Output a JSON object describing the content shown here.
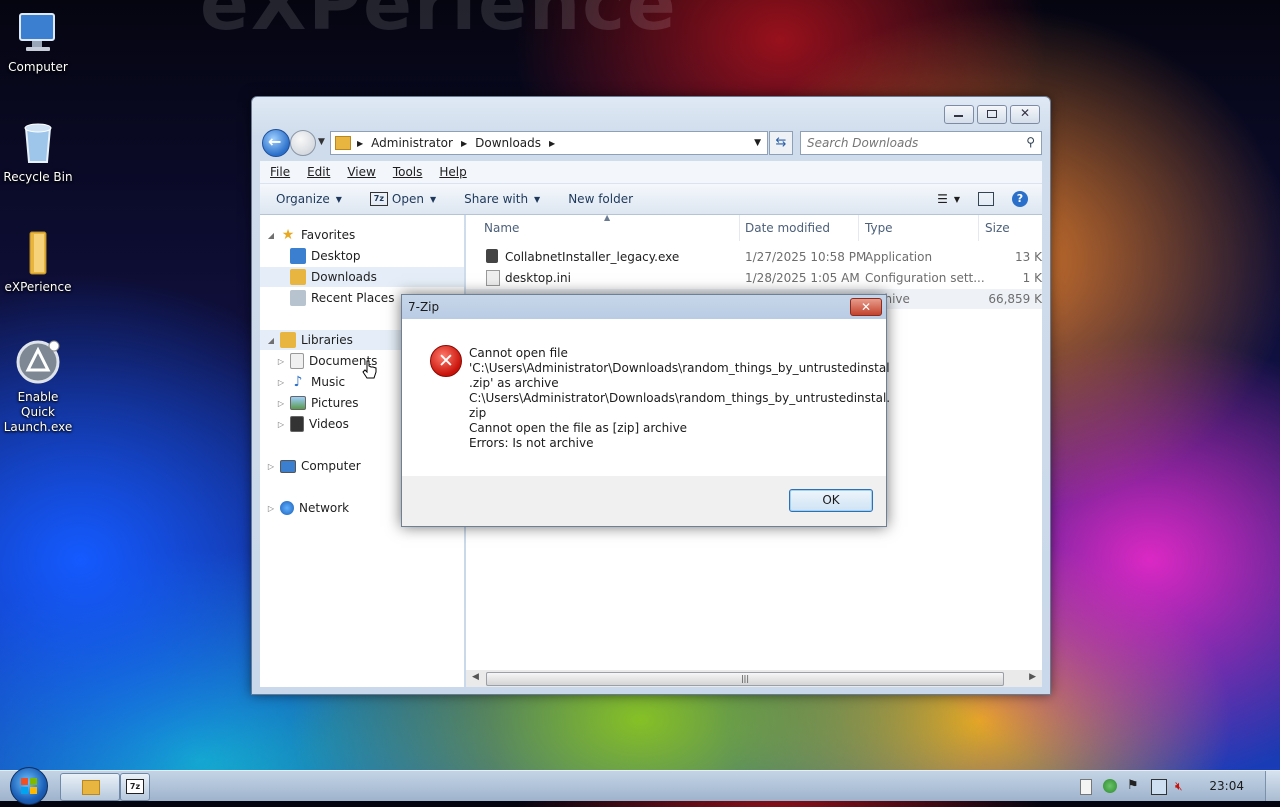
{
  "desktop": {
    "watermark": "eXPerience",
    "icons": [
      {
        "label": "Computer"
      },
      {
        "label": "Recycle Bin"
      },
      {
        "label": "eXPerience"
      },
      {
        "label": "Enable Quick Launch.exe"
      }
    ]
  },
  "explorer": {
    "breadcrumb": [
      "Administrator",
      "Downloads"
    ],
    "search_placeholder": "Search Downloads",
    "menu": [
      "File",
      "Edit",
      "View",
      "Tools",
      "Help"
    ],
    "commands": [
      "Organize",
      "Open",
      "Share with",
      "New folder"
    ],
    "nav": {
      "favorites": "Favorites",
      "favorites_items": [
        "Desktop",
        "Downloads",
        "Recent Places"
      ],
      "libraries": "Libraries",
      "libraries_items": [
        "Documents",
        "Music",
        "Pictures",
        "Videos"
      ],
      "computer": "Computer",
      "network": "Network"
    },
    "columns": [
      "Name",
      "Date modified",
      "Type",
      "Size"
    ],
    "files": [
      {
        "name": "CollabnetInstaller_legacy.exe",
        "date": "1/27/2025 10:58 PM",
        "type": "Application",
        "size": "13 K"
      },
      {
        "name": "desktop.ini",
        "date": "1/28/2025 1:05 AM",
        "type": "Configuration sett...",
        "size": "1 K"
      },
      {
        "name": "",
        "date": "",
        "type": "Archive",
        "size": "66,859 K"
      }
    ]
  },
  "dialog": {
    "title": "7-Zip",
    "close": "✕",
    "message": "Cannot open file\n'C:\\Users\\Administrator\\Downloads\\random_things_by_untrustedinstal\n.zip' as archive\nC:\\Users\\Administrator\\Downloads\\random_things_by_untrustedinstal.\nzip\nCannot open the file as [zip] archive\nErrors: Is not archive",
    "ok": "OK"
  },
  "taskbar": {
    "clock": "23:04",
    "task_7zip": "7z"
  },
  "colors": {
    "window_chrome": "#cfdceb",
    "accent": "#2a6fc9",
    "error_red": "#c8120a"
  }
}
